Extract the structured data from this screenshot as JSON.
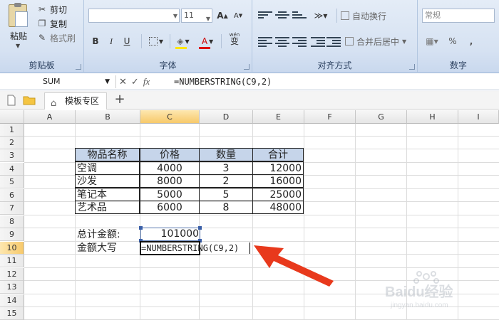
{
  "ribbon": {
    "clipboard": {
      "paste_label": "粘贴",
      "cut_label": "剪切",
      "copy_label": "复制",
      "format_painter_label": "格式刷",
      "group_label": "剪贴板"
    },
    "font": {
      "font_name_value": "",
      "font_size_value": "11",
      "grow_label": "A",
      "shrink_label": "A",
      "bold_label": "B",
      "italic_label": "I",
      "underline_label": "U",
      "font_color_label": "A",
      "phonetic_label": "wén",
      "phonetic_char": "变",
      "group_label": "字体"
    },
    "alignment": {
      "wrap_text_label": "自动换行",
      "merge_center_label": "合并后居中",
      "group_label": "对齐方式"
    },
    "number": {
      "format_value": "常规",
      "percent_label": "%",
      "comma_label": ",",
      "group_label": "数字"
    }
  },
  "formula_bar": {
    "name_box": "SUM",
    "cancel_icon": "✕",
    "enter_icon": "✓",
    "fx_label": "fx",
    "formula": "=NUMBERSTRING(C9,2)"
  },
  "tabs": {
    "template_tab_label": "模板专区",
    "add_tab_label": "+"
  },
  "grid": {
    "columns": [
      "A",
      "B",
      "C",
      "D",
      "E",
      "F",
      "G",
      "H",
      "I"
    ],
    "selected_column": "C",
    "rows": [
      "1",
      "2",
      "3",
      "4",
      "5",
      "6",
      "7",
      "8",
      "9",
      "10",
      "11",
      "12",
      "13",
      "14",
      "15"
    ],
    "selected_row": "10"
  },
  "table": {
    "headers": [
      "物品名称",
      "价格",
      "数量",
      "合计"
    ],
    "rows": [
      [
        "空调",
        "4000",
        "3",
        "12000"
      ],
      [
        "沙发",
        "8000",
        "2",
        "16000"
      ],
      [
        "笔记本",
        "5000",
        "5",
        "25000"
      ],
      [
        "艺术品",
        "6000",
        "8",
        "48000"
      ]
    ]
  },
  "summary": {
    "total_label": "总计金额:",
    "total_value": "101000",
    "uppercase_label": "金额大写",
    "c10_formula": "=NUMBERSTRING(C9,2)"
  },
  "watermark": {
    "brand": "Baidu经验",
    "url": "jingyan.baidu.com"
  },
  "colors": {
    "table_header_bg": "#c6d5ea",
    "selected_header": "#f7c96a",
    "arrow": "#e8391c"
  }
}
